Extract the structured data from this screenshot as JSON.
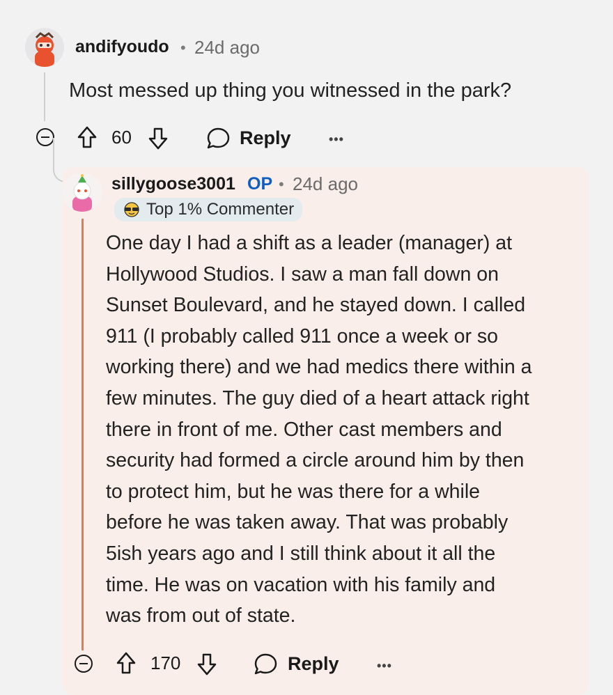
{
  "parent_comment": {
    "username": "andifyoudo",
    "separator": "•",
    "time": "24d ago",
    "body": "Most messed up thing you witnessed in the park?",
    "votes": "60",
    "reply_label": "Reply",
    "more_label": "•••"
  },
  "reply_comment": {
    "username": "sillygoose3001",
    "op_badge": "OP",
    "separator": "•",
    "time": "24d ago",
    "flair": "Top 1% Commenter",
    "body_lines": [
      "One day I had a shift as a leader (manager) at",
      "Hollywood Studios. I saw a man fall down on",
      "Sunset Boulevard, and he stayed down. I called",
      "911 (I probably called 911 once a week or so",
      "working there) and we had medics there within a",
      "few minutes. The guy died of a heart attack right",
      "there in front of me. Other cast members and",
      "security had formed a circle around him by then",
      "to protect him, but he was there for a while",
      "before he was taken away. That was probably",
      "5ish years ago and I still think about it all the",
      "time. He was on vacation with his family and",
      "was from out of state."
    ],
    "votes": "170",
    "reply_label": "Reply",
    "more_label": "•••"
  }
}
